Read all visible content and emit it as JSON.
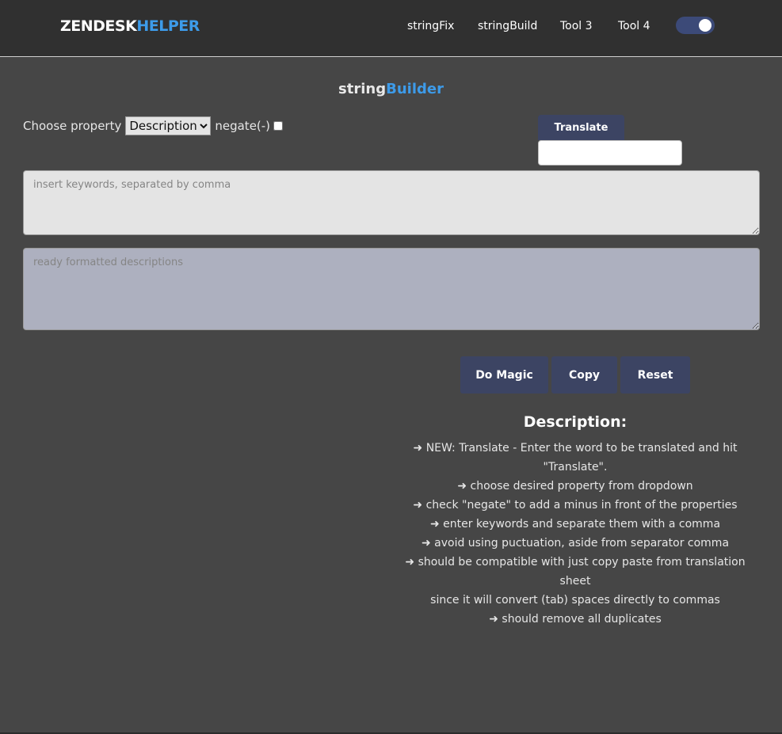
{
  "brand": {
    "part1": "ZENDESK",
    "part2": "HELPER"
  },
  "nav": {
    "links": [
      "stringFix",
      "stringBuild",
      "Tool 3",
      "Tool 4"
    ]
  },
  "theme_toggle": {
    "on": true
  },
  "page_title": {
    "part1": "string",
    "part2": "Builder"
  },
  "property": {
    "label": "Choose property",
    "selected": "Description",
    "negate_label": "negate(-)",
    "negate_checked": false
  },
  "translate": {
    "button_label": "Translate",
    "value": ""
  },
  "keywords": {
    "placeholder": "insert keywords, separated by comma",
    "value": ""
  },
  "output": {
    "placeholder": "ready formatted descriptions",
    "value": ""
  },
  "actions": {
    "magic": "Do Magic",
    "copy": "Copy",
    "reset": "Reset"
  },
  "description": {
    "heading": "Description:",
    "lines": [
      "➜ NEW: Translate - Enter the word to be translated and hit \"Translate\".",
      "➜ choose desired property from dropdown",
      "➜ check \"negate\" to add a minus in front of the properties",
      "➜ enter keywords and separate them with a comma",
      "➜ avoid using puctuation, aside from separator comma",
      "➜ should be compatible with just copy paste from translation sheet",
      "since it will convert (tab) spaces directly to commas",
      "➜ should remove all duplicates"
    ]
  },
  "colors": {
    "accent": "#3d9be9",
    "button": "#3c4463",
    "background": "#464646",
    "navbar": "#303030"
  }
}
